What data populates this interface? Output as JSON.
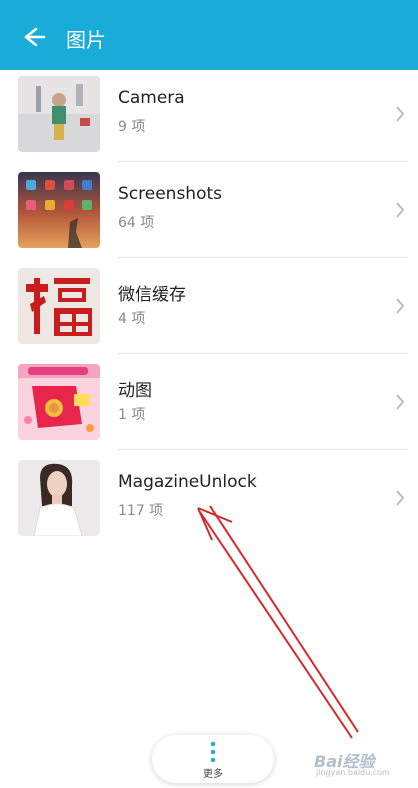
{
  "header": {
    "title": "图片",
    "back_icon": "back-arrow-icon"
  },
  "albums": [
    {
      "name": "Camera",
      "count": "9 项"
    },
    {
      "name": "Screenshots",
      "count": "64 项"
    },
    {
      "name": "微信缓存",
      "count": "4 项"
    },
    {
      "name": "动图",
      "count": "1 项"
    },
    {
      "name": "MagazineUnlock",
      "count": "117 项"
    }
  ],
  "bottom": {
    "more_label": "更多"
  },
  "watermark": {
    "logo": "Bai经验",
    "sub": "jingyan.baidu.com"
  },
  "colors": {
    "app_bar": "#1aacd9",
    "annotation_arrow": "#d42a2a"
  }
}
